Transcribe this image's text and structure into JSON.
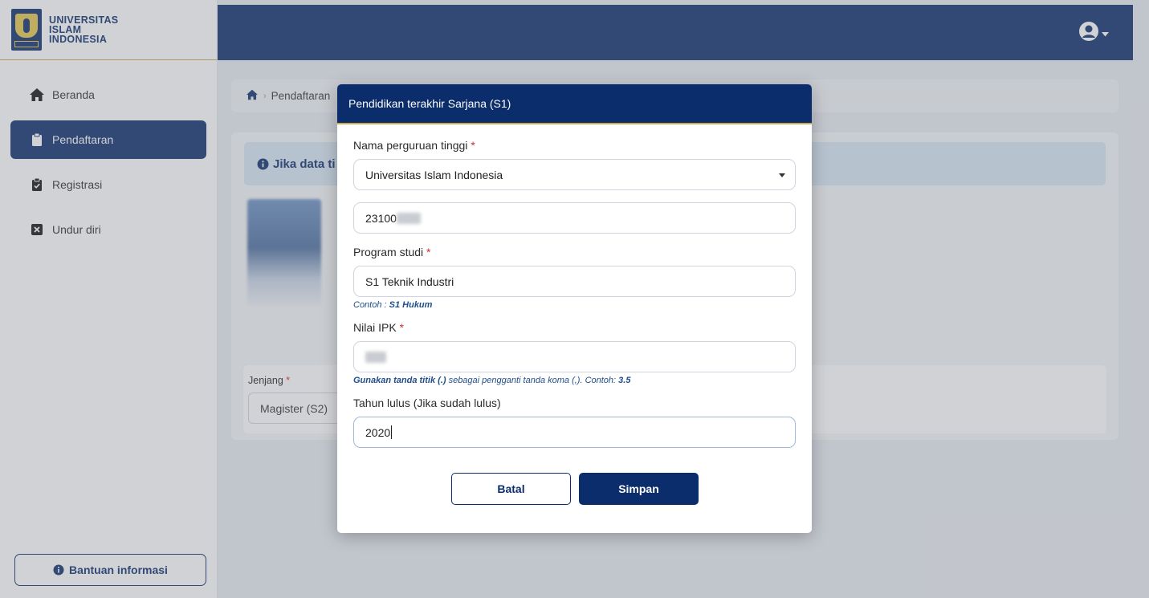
{
  "brand": {
    "line1": "UNIVERSITAS",
    "line2": "ISLAM",
    "line3": "INDONESIA"
  },
  "sidebar": {
    "items": [
      {
        "label": "Beranda",
        "icon": "home-icon",
        "active": false
      },
      {
        "label": "Pendaftaran",
        "icon": "clipboard-icon",
        "active": true
      },
      {
        "label": "Registrasi",
        "icon": "clipboard-check-icon",
        "active": false
      },
      {
        "label": "Undur diri",
        "icon": "close-box-icon",
        "active": false
      }
    ],
    "help_label": "Bantuan informasi"
  },
  "topbar": {
    "user_icon": "user-circle-icon"
  },
  "background": {
    "breadcrumb": [
      "Pendaftaran"
    ],
    "alert_text": "Jika data ti",
    "jenjang_label": "Jenjang",
    "jenjang_value": "Magister (S2)"
  },
  "modal": {
    "title": "Pendidikan terakhir Sarjana (S1)",
    "university_label": "Nama perguruan tinggi",
    "university_value": "Universitas Islam Indonesia",
    "student_id_value": "23100",
    "program_label": "Program studi",
    "program_value": "S1 Teknik Industri",
    "program_hint_prefix": "Contoh : ",
    "program_hint_example": "S1 Hukum",
    "ipk_label": "Nilai IPK",
    "ipk_hint_bold": "Gunakan tanda titik (.)",
    "ipk_hint_text": " sebagai pengganti tanda koma (,). Contoh: ",
    "ipk_hint_example": "3.5",
    "year_label": "Tahun lulus (Jika sudah lulus)",
    "year_value": "2020",
    "required_mark": "*",
    "cancel_label": "Batal",
    "save_label": "Simpan"
  },
  "colors": {
    "primary": "#0b2d6b",
    "accent_gold": "#c9ab4e",
    "required": "#d32f2f"
  }
}
